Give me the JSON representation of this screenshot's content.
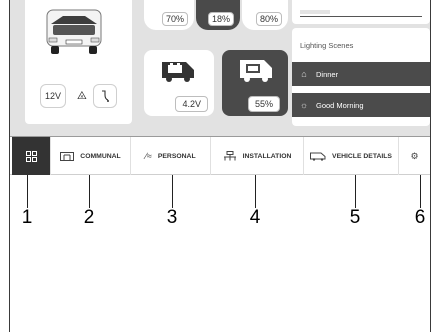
{
  "vehicle": {
    "battery_chip": "12V",
    "plug_icon": "plug-icon",
    "cable_icon": "hose-icon"
  },
  "stats": [
    {
      "value": "70%",
      "style": "white"
    },
    {
      "value": "18%",
      "style": "dark"
    },
    {
      "value": "80%",
      "style": "white"
    }
  ],
  "tiles": [
    {
      "value": "4.2V",
      "style": "white",
      "icon": "van-battery-icon"
    },
    {
      "value": "55%",
      "style": "dark",
      "icon": "van-battery-icon"
    }
  ],
  "lighting": {
    "title": "Lighting Scenes",
    "scenes": [
      {
        "label": "Dinner",
        "icon": "lamp-icon"
      },
      {
        "label": "Good Morning",
        "icon": "sunrise-icon"
      }
    ]
  },
  "nav": {
    "communal": "COMMUNAL",
    "personal": "PERSONAL",
    "installation": "INSTALLATION",
    "vehicle_details": "VEHICLE DETAILS"
  },
  "callouts": [
    "1",
    "2",
    "3",
    "4",
    "5",
    "6"
  ],
  "colors": {
    "panel_bg": "#e2e2e2",
    "dark_tile": "#4a4a4a",
    "scene_bg": "#4b4b4b",
    "nav_active": "#333333"
  }
}
